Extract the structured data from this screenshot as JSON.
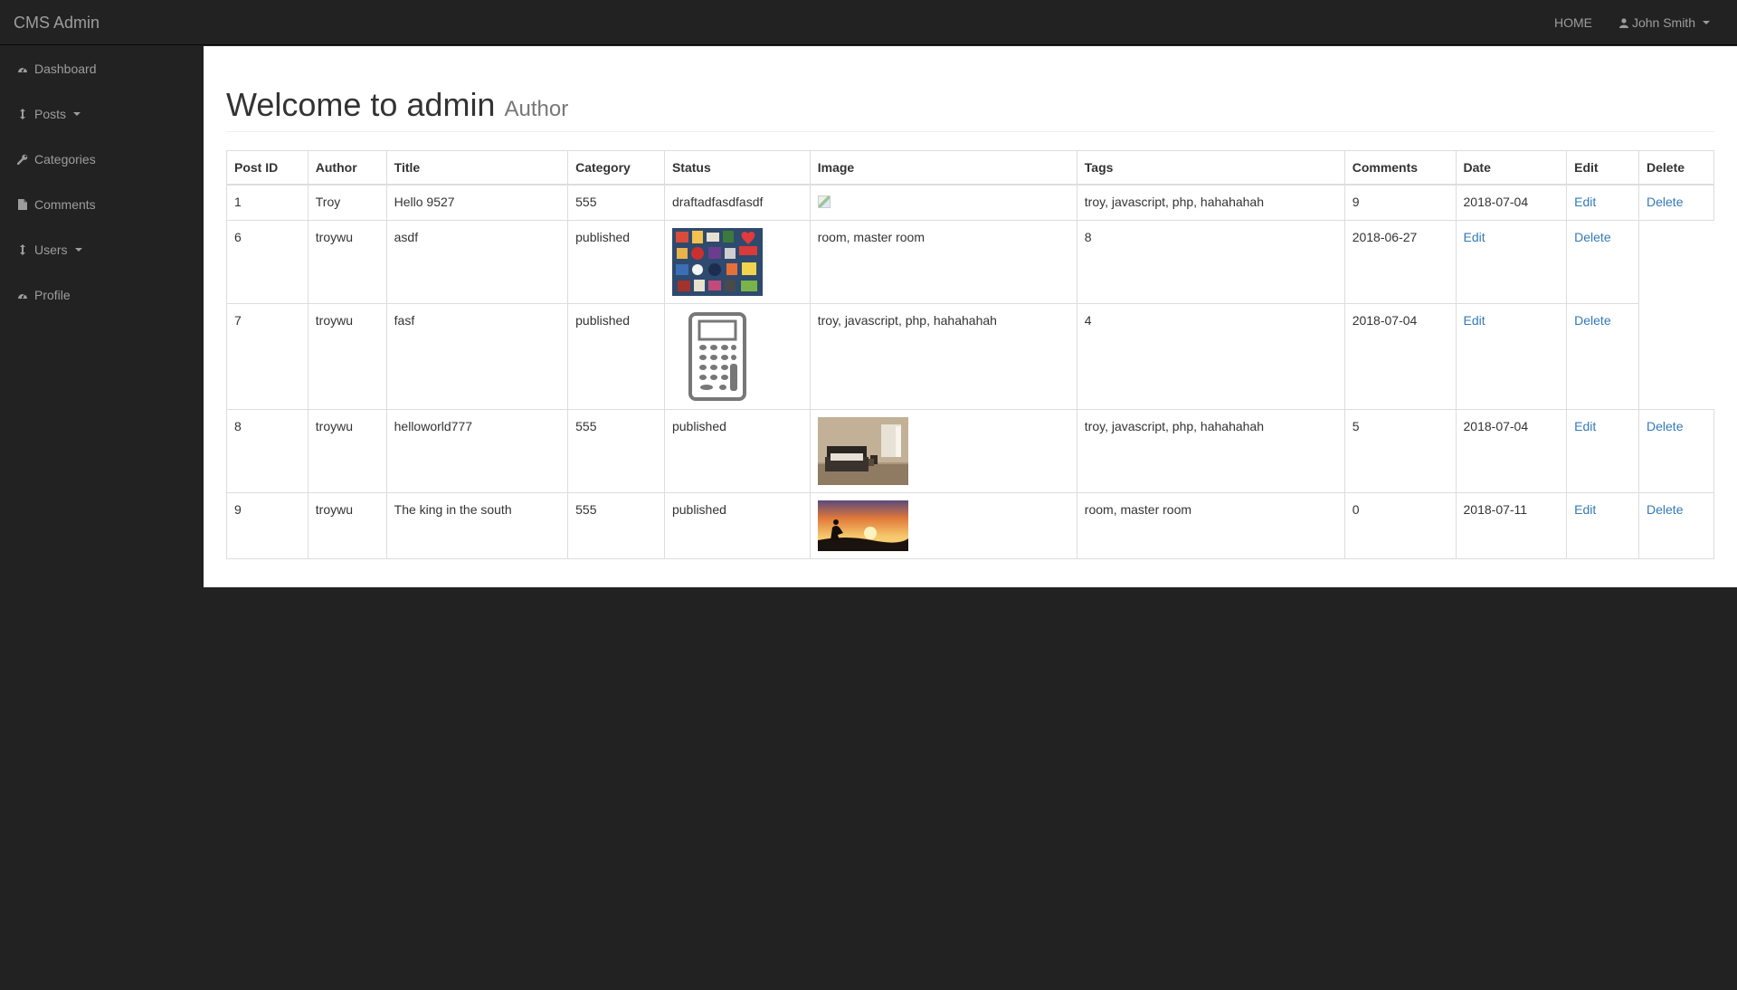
{
  "navbar": {
    "brand": "CMS Admin",
    "home_label": "HOME",
    "user_label": "John Smith"
  },
  "sidebar": {
    "items": [
      {
        "label": "Dashboard",
        "icon": "dashboard-icon",
        "has_caret": false
      },
      {
        "label": "Posts",
        "icon": "arrows-v-icon",
        "has_caret": true
      },
      {
        "label": "Categories",
        "icon": "wrench-icon",
        "has_caret": false
      },
      {
        "label": "Comments",
        "icon": "file-icon",
        "has_caret": false
      },
      {
        "label": "Users",
        "icon": "arrows-v-icon",
        "has_caret": true
      },
      {
        "label": "Profile",
        "icon": "dashboard-icon",
        "has_caret": false
      }
    ]
  },
  "header": {
    "title": "Welcome to admin",
    "subtitle": "Author"
  },
  "table": {
    "columns": [
      "Post ID",
      "Author",
      "Title",
      "Category",
      "Status",
      "Image",
      "Tags",
      "Comments",
      "Date",
      "Edit",
      "Delete"
    ],
    "rows": [
      {
        "id": "1",
        "author": "Troy",
        "title": "Hello 9527",
        "category": "555",
        "status": "draftadfasdfasdf",
        "image": "broken-image-icon",
        "tags": "troy, javascript, php, hahahahah",
        "comments": "9",
        "date": "2018-07-04",
        "edit": "Edit",
        "delete": "Delete"
      },
      {
        "id": "6",
        "author": "troywu",
        "title": "asdf",
        "status": "published",
        "image": "stickers-collage-image",
        "tags": "room, master room",
        "comments": "8",
        "date": "2018-06-27",
        "edit": "Edit",
        "delete": "Delete"
      },
      {
        "id": "7",
        "author": "troywu",
        "title": "fasf",
        "status": "published",
        "image": "calculator-image",
        "tags": "troy, javascript, php, hahahahah",
        "comments": "4",
        "date": "2018-07-04",
        "edit": "Edit",
        "delete": "Delete"
      },
      {
        "id": "8",
        "author": "troywu",
        "title": "helloworld777",
        "category": "555",
        "status": "published",
        "image": "bedroom-image",
        "tags": "troy, javascript, php, hahahahah",
        "comments": "5",
        "date": "2018-07-04",
        "edit": "Edit",
        "delete": "Delete"
      },
      {
        "id": "9",
        "author": "troywu",
        "title": "The king in the south",
        "category": "555",
        "status": "published",
        "image": "sunset-image",
        "tags": "room, master room",
        "comments": "0",
        "date": "2018-07-11",
        "edit": "Edit",
        "delete": "Delete"
      }
    ]
  },
  "colors": {
    "navbar_bg": "#222222",
    "nav_text": "#9d9d9d",
    "link": "#337ab7",
    "page_bg": "#ffffff"
  }
}
